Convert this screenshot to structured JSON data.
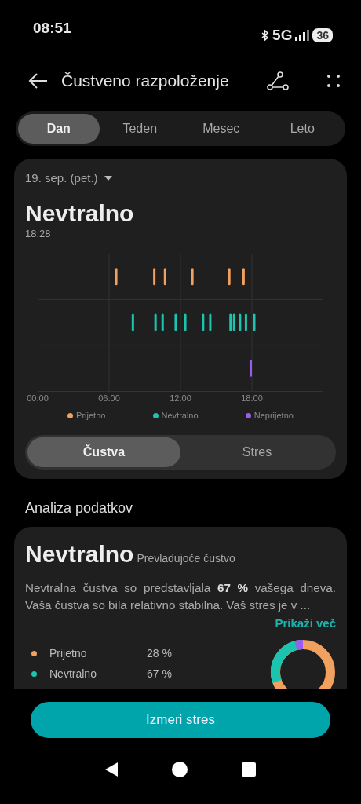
{
  "status_bar": {
    "time": "08:51",
    "network": "5G",
    "battery": "36"
  },
  "header": {
    "title": "Čustveno razpoloženje"
  },
  "period_tabs": [
    {
      "label": "Dan",
      "selected": true
    },
    {
      "label": "Teden",
      "selected": false
    },
    {
      "label": "Mesec",
      "selected": false
    },
    {
      "label": "Leto",
      "selected": false
    }
  ],
  "summary_card": {
    "date": "19. sep. (pet.)",
    "mood": "Nevtralno",
    "time": "18:28",
    "timeline_axis_labels": [
      "00:00",
      "06:00",
      "12:00",
      "18:00"
    ],
    "legend": [
      {
        "label": "Prijetno",
        "color": "#f2a05e"
      },
      {
        "label": "Nevtralno",
        "color": "#1cc4b0"
      },
      {
        "label": "Neprijetno",
        "color": "#9b5cf0"
      }
    ],
    "view_tabs": [
      {
        "label": "Čustva",
        "selected": true
      },
      {
        "label": "Stres",
        "selected": false
      }
    ]
  },
  "analysis": {
    "heading": "Analiza podatkov",
    "mood": "Nevtralno",
    "subtitle": "Prevladujoče čustvo",
    "text": "Nevtralna čustva so predstavljala **67 %** vašega dneva. Vaša čustva so bila relativno stabilna. Vaš stres je v ...",
    "more_link": "Prikaži več",
    "breakdown": [
      {
        "label": "Prijetno",
        "value": "28 %",
        "color": "#f2a05e"
      },
      {
        "label": "Nevtralno",
        "value": "67 %",
        "color": "#1cc4b0"
      }
    ]
  },
  "primary_button": "Izmeri stres"
}
